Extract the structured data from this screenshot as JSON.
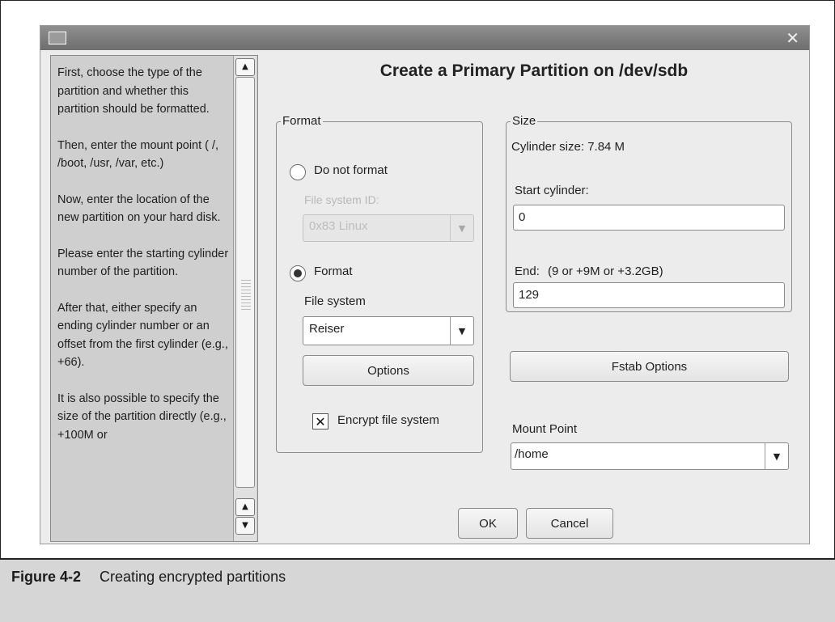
{
  "window": {
    "title_icon": "window-menu-icon",
    "close_glyph": "✕",
    "dialog_title": "Create a Primary Partition on /dev/sdb"
  },
  "help": {
    "paragraphs": [
      "First, choose the type of the partition and whether this partition should be formatted.",
      "Then, enter the mount point ( /, /boot, /usr, /var, etc.)",
      "Now, enter the location of the new partition on your hard disk.",
      "Please enter the starting cylinder number of the partition.",
      "After that, either specify an ending cylinder number or an offset from the first cylinder (e.g., +66).",
      "It is also possible to specify the size of the partition directly (e.g., +100M or"
    ],
    "scroll_up_glyph": "▲",
    "scroll_down_glyph": "▼"
  },
  "format": {
    "group_label": "Format",
    "do_not_format_label": "Do not format",
    "file_system_id_label": "File system ID:",
    "file_system_id_value": "0x83 Linux",
    "format_label": "Format",
    "file_system_label": "File system",
    "file_system_value": "Reiser",
    "options_button": "Options",
    "encrypt_label": "Encrypt file system",
    "encrypt_checked": true,
    "selected": "Format"
  },
  "size": {
    "group_label": "Size",
    "cylinder_size": "Cylinder size: 7.84 M",
    "start_label": "Start cylinder:",
    "start_value": "0",
    "end_label": "End:",
    "end_hint": "(9 or +9M or +3.2GB)",
    "end_value": "129"
  },
  "fstab_button": "Fstab Options",
  "mount": {
    "label": "Mount Point",
    "value": "/home"
  },
  "ok_button": "OK",
  "cancel_button": "Cancel",
  "caption": {
    "number": "Figure 4-2",
    "text": "Creating encrypted partitions"
  }
}
